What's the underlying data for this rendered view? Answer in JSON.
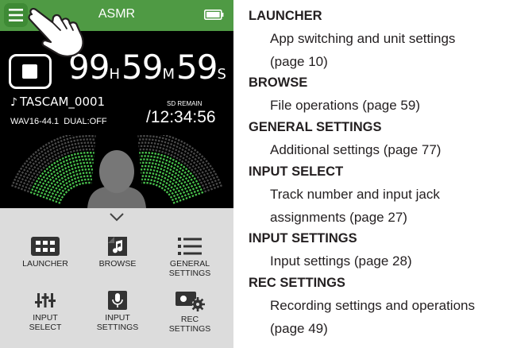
{
  "screen": {
    "title": "ASMR",
    "counter": {
      "hours": "99",
      "hours_unit": "H",
      "minutes": "59",
      "minutes_unit": "M",
      "seconds": "59",
      "seconds_unit": "S"
    },
    "file": {
      "note_symbol": "♪",
      "name": "TASCAM_0001",
      "info": "WAV16-44.1  DUAL:OFF"
    },
    "sd": {
      "label": "SD REMAIN",
      "value": "/12:34:56"
    },
    "colors": {
      "titlebar": "#4f9a44",
      "meter_green": "#49c24d",
      "panel": "#dcdcdc"
    },
    "menu": [
      {
        "label": "LAUNCHER",
        "icon": "grid-icon"
      },
      {
        "label": "BROWSE",
        "icon": "music-file-icon"
      },
      {
        "label": "GENERAL\nSETTINGS",
        "icon": "list-icon"
      },
      {
        "label": "INPUT\nSELECT",
        "icon": "input-select-icon"
      },
      {
        "label": "INPUT\nSETTINGS",
        "icon": "microphone-icon"
      },
      {
        "label": "REC\nSETTINGS",
        "icon": "rec-gear-icon"
      }
    ]
  },
  "descriptions": [
    {
      "term": "LAUNCHER",
      "lines": [
        "App switching and unit settings",
        "(page 10)"
      ]
    },
    {
      "term": "BROWSE",
      "lines": [
        "File operations (page 59)"
      ]
    },
    {
      "term": "GENERAL SETTINGS",
      "lines": [
        "Additional settings (page 77)"
      ]
    },
    {
      "term": "INPUT SELECT",
      "lines": [
        "Track number and input jack",
        "assignments (page 27)"
      ]
    },
    {
      "term": "INPUT SETTINGS",
      "lines": [
        "Input settings (page 28)"
      ]
    },
    {
      "term": "REC SETTINGS",
      "lines": [
        "Recording settings and operations",
        "(page 49)"
      ]
    }
  ]
}
